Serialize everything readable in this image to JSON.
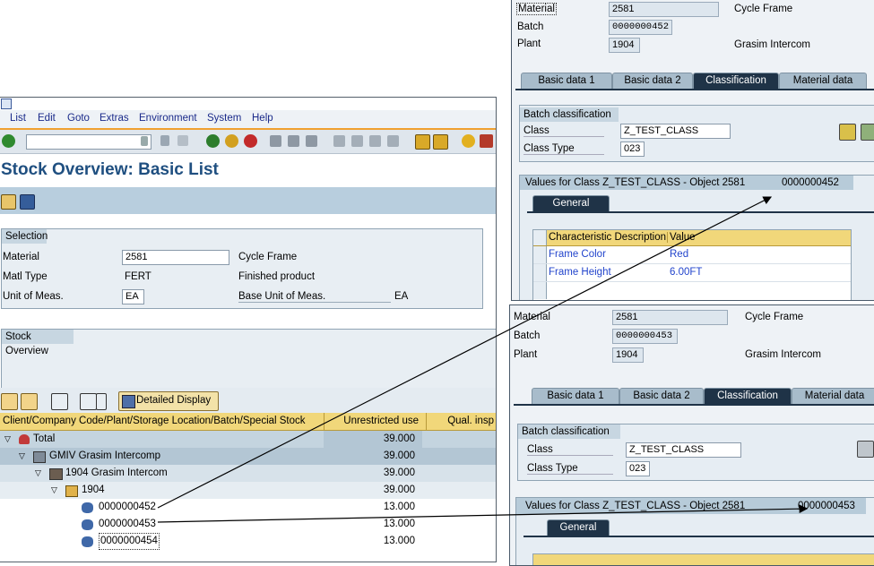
{
  "left": {
    "menu": [
      "List",
      "Edit",
      "Goto",
      "Extras",
      "Environment",
      "System",
      "Help"
    ],
    "title": "Stock Overview: Basic List",
    "selection": {
      "header": "Selection",
      "rows": [
        {
          "label": "Material",
          "value": "2581",
          "desc": "Cycle Frame"
        },
        {
          "label": "Matl Type",
          "value": "FERT",
          "desc": "Finished product"
        },
        {
          "label": "Unit of Meas.",
          "value": "EA",
          "desc": "Base Unit of Meas.",
          "extra": "EA"
        }
      ]
    },
    "stock_overview_header": "Stock Overview",
    "detailed_display_label": "Detailed Display",
    "table": {
      "col1": "Client/Company Code/Plant/Storage Location/Batch/Special Stock",
      "col2": "Unrestricted use",
      "col3": "Qual. insp",
      "rows": [
        {
          "label": "Total",
          "value": "39.000"
        },
        {
          "label": "GMIV Grasim Intercomp",
          "value": "39.000"
        },
        {
          "label": "1904 Grasim Intercom",
          "value": "39.000"
        },
        {
          "label": "1904",
          "value": "39.000"
        },
        {
          "label": "0000000452",
          "value": "13.000"
        },
        {
          "label": "0000000453",
          "value": "13.000"
        },
        {
          "label": "0000000454",
          "value": "13.000"
        }
      ]
    }
  },
  "top_right": {
    "material_label": "Material",
    "material_value": "2581",
    "material_desc": "Cycle Frame",
    "batch_label": "Batch",
    "batch_value": "0000000452",
    "plant_label": "Plant",
    "plant_value": "1904",
    "plant_desc": "Grasim Intercom",
    "tabs": [
      "Basic data 1",
      "Basic data 2",
      "Classification",
      "Material data"
    ],
    "batch_class_header": "Batch classification",
    "class_label": "Class",
    "class_value": "Z_TEST_CLASS",
    "class_type_label": "Class Type",
    "class_type_value": "023",
    "values_header": "Values for Class Z_TEST_CLASS - Object 2581",
    "values_batch": "0000000452",
    "general_tab": "General",
    "char_col": "Characteristic Description",
    "value_col": "Value",
    "chars": [
      {
        "name": "Frame Color",
        "value": "Red"
      },
      {
        "name": "Frame Height",
        "value": "6.00FT"
      }
    ]
  },
  "bottom_right": {
    "material_label": "Material",
    "material_value": "2581",
    "material_desc": "Cycle Frame",
    "batch_label": "Batch",
    "batch_value": "0000000453",
    "plant_label": "Plant",
    "plant_value": "1904",
    "plant_desc": "Grasim Intercom",
    "tabs": [
      "Basic data 1",
      "Basic data 2",
      "Classification",
      "Material data"
    ],
    "batch_class_header": "Batch classification",
    "class_label": "Class",
    "class_value": "Z_TEST_CLASS",
    "class_type_label": "Class Type",
    "class_type_value": "023",
    "values_header": "Values for Class Z_TEST_CLASS - Object 2581",
    "values_batch": "0000000453",
    "general_tab": "General"
  },
  "colors": {
    "accent_orange": "#f0a030",
    "link_blue": "#2244cc",
    "title_blue": "#1f4f80"
  }
}
